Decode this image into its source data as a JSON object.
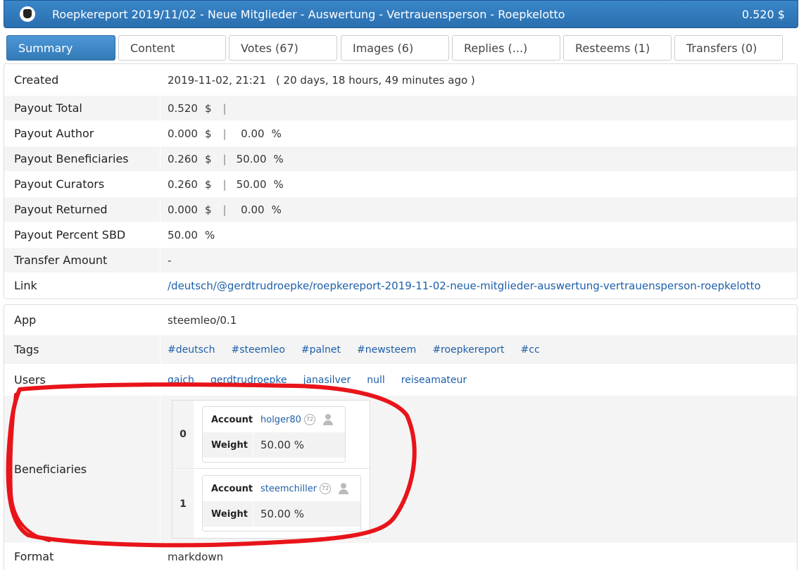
{
  "header": {
    "title": "Roepkereport 2019/11/02 - Neue Mitglieder - Auswertung - Vertrauensperson - Roepkelotto",
    "amount": "0.520 $"
  },
  "tabs": [
    {
      "label": "Summary"
    },
    {
      "label": "Content"
    },
    {
      "label": "Votes (67)"
    },
    {
      "label": "Images (6)"
    },
    {
      "label": "Replies (...)"
    },
    {
      "label": "Resteems (1)"
    },
    {
      "label": "Transfers (0)"
    }
  ],
  "summary": {
    "created": {
      "key": "Created",
      "date": "2019-11-02, 21:21",
      "ago": "( 20 days, 18 hours, 49 minutes ago )"
    },
    "payout_total": {
      "key": "Payout Total",
      "amount": "0.520",
      "unit": "$",
      "sep": "|"
    },
    "payout_author": {
      "key": "Payout Author",
      "amount": "0.000",
      "unit": "$",
      "sep": "|",
      "pct": "0.00",
      "pct_unit": "%"
    },
    "payout_beneficiaries": {
      "key": "Payout Beneficiaries",
      "amount": "0.260",
      "unit": "$",
      "sep": "|",
      "pct": "50.00",
      "pct_unit": "%"
    },
    "payout_curators": {
      "key": "Payout Curators",
      "amount": "0.260",
      "unit": "$",
      "sep": "|",
      "pct": "50.00",
      "pct_unit": "%"
    },
    "payout_returned": {
      "key": "Payout Returned",
      "amount": "0.000",
      "unit": "$",
      "sep": "|",
      "pct": "0.00",
      "pct_unit": "%"
    },
    "payout_percent_sbd": {
      "key": "Payout Percent SBD",
      "pct": "50.00",
      "pct_unit": "%"
    },
    "transfer_amount": {
      "key": "Transfer Amount",
      "value": "-"
    },
    "link": {
      "key": "Link",
      "value": "/deutsch/@gerdtrudroepke/roepkereport-2019-11-02-neue-mitglieder-auswertung-vertrauensperson-roepkelotto"
    }
  },
  "meta": {
    "app": {
      "key": "App",
      "value": "steemleo/0.1"
    },
    "tags": {
      "key": "Tags",
      "items": [
        "#deutsch",
        "#steemleo",
        "#palnet",
        "#newsteem",
        "#roepkereport",
        "#cc"
      ]
    },
    "users": {
      "key": "Users",
      "items": [
        "gaich",
        "gerdtrudroepke",
        "janasilver",
        "null",
        "reiseamateur"
      ]
    },
    "beneficiaries": {
      "key": "Beneficiaries",
      "account_label": "Account",
      "weight_label": "Weight",
      "items": [
        {
          "index": "0",
          "account": "holger80",
          "rep": "72",
          "weight": "50.00 %"
        },
        {
          "index": "1",
          "account": "steemchiller",
          "rep": "72",
          "weight": "50.00 %"
        }
      ]
    },
    "format": {
      "key": "Format",
      "value": "markdown"
    }
  },
  "colors": {
    "accent": "#337ab7",
    "link": "#1d5fa8",
    "annotation": "#e8141a"
  }
}
